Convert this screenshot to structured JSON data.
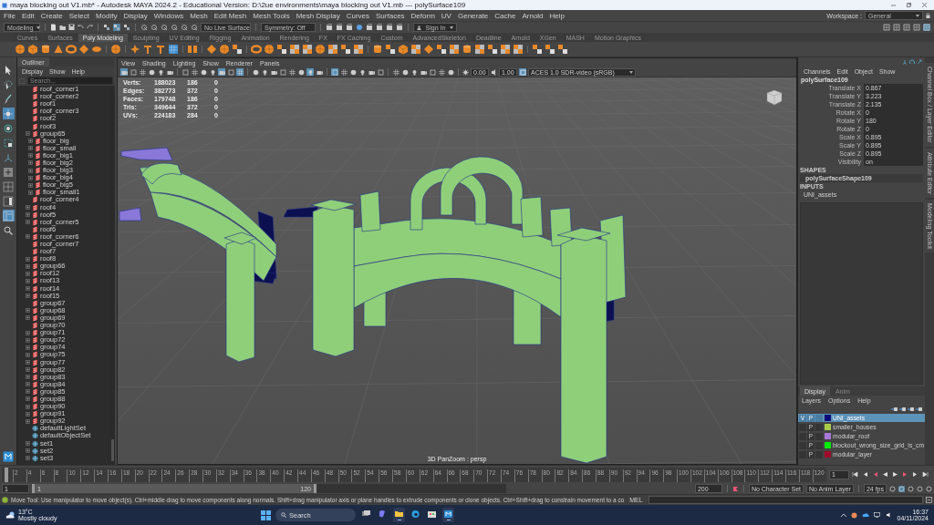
{
  "window": {
    "title": "maya blocking out V1.mb* - Autodesk MAYA 2024.2 - Educational Version: D:\\2ue environments\\maya blocking out V1.mb  ---  polySurface109"
  },
  "menu_bar": [
    "File",
    "Edit",
    "Create",
    "Select",
    "Modify",
    "Display",
    "Windows",
    "Mesh",
    "Edit Mesh",
    "Mesh Tools",
    "Mesh Display",
    "Curves",
    "Surfaces",
    "Deform",
    "UV",
    "Generate",
    "Cache",
    "Arnold",
    "Help"
  ],
  "workspace": {
    "label": "Workspace :",
    "value": "General"
  },
  "status_line": {
    "mode": "Modeling",
    "live_surface": "No Live Surface",
    "symmetry": "Symmetry: Off",
    "sign_in": "Sign In"
  },
  "shelf_tabs": [
    {
      "label": "Curves",
      "selected": false
    },
    {
      "label": "Surfaces",
      "selected": false
    },
    {
      "label": "Poly Modeling",
      "selected": true
    },
    {
      "label": "Sculpting",
      "selected": false
    },
    {
      "label": "UV Editing",
      "selected": false
    },
    {
      "label": "Rigging",
      "selected": false
    },
    {
      "label": "Animation",
      "selected": false
    },
    {
      "label": "Rendering",
      "selected": false
    },
    {
      "label": "FX",
      "selected": false
    },
    {
      "label": "FX Caching",
      "selected": false
    },
    {
      "label": "Custom",
      "selected": false
    },
    {
      "label": "AdvancedSkeleton",
      "selected": false
    },
    {
      "label": "Deadline",
      "selected": false
    },
    {
      "label": "Arnold",
      "selected": false
    },
    {
      "label": "XGen",
      "selected": false
    },
    {
      "label": "MASH",
      "selected": false
    },
    {
      "label": "Motion Graphics",
      "selected": false
    }
  ],
  "tools": [
    {
      "kind": "select",
      "selected": false
    },
    {
      "kind": "lasso",
      "selected": false
    },
    {
      "kind": "paint",
      "selected": false
    },
    {
      "kind": "move",
      "selected": true
    },
    {
      "kind": "rotate",
      "selected": false
    },
    {
      "kind": "scale",
      "selected": false
    },
    {
      "kind": "manipulator",
      "selected": false
    },
    {
      "kind": "single-view",
      "selected": false
    },
    {
      "kind": "four-view",
      "selected": false
    },
    {
      "kind": "two-view",
      "selected": false
    },
    {
      "kind": "outliner-view",
      "selected": true
    },
    {
      "kind": "zoom",
      "selected": false
    }
  ],
  "outliner": {
    "title": "Outliner",
    "menu": [
      "Display",
      "Show",
      "Help"
    ],
    "search_placeholder": "Search...",
    "items": [
      {
        "name": "roof_corner1",
        "kind": "mesh",
        "collapsed": false
      },
      {
        "name": "roof_corner2",
        "kind": "mesh",
        "collapsed": false
      },
      {
        "name": "roof1",
        "kind": "mesh",
        "collapsed": false
      },
      {
        "name": "roof_corner3",
        "kind": "mesh",
        "collapsed": false
      },
      {
        "name": "roof2",
        "kind": "mesh",
        "collapsed": false
      },
      {
        "name": "roof3",
        "kind": "mesh",
        "collapsed": false
      },
      {
        "name": "group65",
        "kind": "mesh",
        "collapsed": false,
        "children": [
          {
            "name": "floor_big",
            "kind": "mesh",
            "collapsed": true
          },
          {
            "name": "floor_small",
            "kind": "mesh",
            "collapsed": true
          },
          {
            "name": "floor_big1",
            "kind": "mesh",
            "collapsed": true
          },
          {
            "name": "floor_big2",
            "kind": "mesh",
            "collapsed": true
          },
          {
            "name": "floor_big3",
            "kind": "mesh",
            "collapsed": true
          },
          {
            "name": "floor_big4",
            "kind": "mesh",
            "collapsed": true
          },
          {
            "name": "floor_big5",
            "kind": "mesh",
            "collapsed": true
          },
          {
            "name": "floor_small1",
            "kind": "mesh",
            "collapsed": true
          }
        ]
      },
      {
        "name": "roof_corner4",
        "kind": "mesh",
        "collapsed": false
      },
      {
        "name": "roof4",
        "kind": "mesh",
        "collapsed": true
      },
      {
        "name": "roof5",
        "kind": "mesh",
        "collapsed": true
      },
      {
        "name": "roof_corner5",
        "kind": "mesh",
        "collapsed": true
      },
      {
        "name": "roof6",
        "kind": "mesh",
        "collapsed": false
      },
      {
        "name": "roof_corner6",
        "kind": "mesh",
        "collapsed": true
      },
      {
        "name": "roof_corner7",
        "kind": "mesh",
        "collapsed": false
      },
      {
        "name": "roof7",
        "kind": "mesh",
        "collapsed": false
      },
      {
        "name": "roof8",
        "kind": "mesh",
        "collapsed": true
      },
      {
        "name": "group66",
        "kind": "mesh",
        "collapsed": true
      },
      {
        "name": "roof12",
        "kind": "mesh",
        "collapsed": true
      },
      {
        "name": "roof13",
        "kind": "mesh",
        "collapsed": true
      },
      {
        "name": "roof14",
        "kind": "mesh",
        "collapsed": true
      },
      {
        "name": "roof15",
        "kind": "mesh",
        "collapsed": true
      },
      {
        "name": "group67",
        "kind": "mesh",
        "collapsed": false
      },
      {
        "name": "group68",
        "kind": "mesh",
        "collapsed": true
      },
      {
        "name": "group69",
        "kind": "mesh",
        "collapsed": true
      },
      {
        "name": "group70",
        "kind": "mesh",
        "collapsed": false
      },
      {
        "name": "group71",
        "kind": "mesh",
        "collapsed": true
      },
      {
        "name": "group72",
        "kind": "mesh",
        "collapsed": true
      },
      {
        "name": "group74",
        "kind": "mesh",
        "collapsed": true
      },
      {
        "name": "group75",
        "kind": "mesh",
        "collapsed": true
      },
      {
        "name": "group77",
        "kind": "mesh",
        "collapsed": true
      },
      {
        "name": "group82",
        "kind": "mesh",
        "collapsed": true
      },
      {
        "name": "group83",
        "kind": "mesh",
        "collapsed": true
      },
      {
        "name": "group84",
        "kind": "mesh",
        "collapsed": true
      },
      {
        "name": "group85",
        "kind": "mesh",
        "collapsed": true
      },
      {
        "name": "group88",
        "kind": "mesh",
        "collapsed": true
      },
      {
        "name": "group90",
        "kind": "mesh",
        "collapsed": true
      },
      {
        "name": "group91",
        "kind": "mesh",
        "collapsed": true
      },
      {
        "name": "group92",
        "kind": "mesh",
        "collapsed": true
      },
      {
        "name": "defaultLightSet",
        "kind": "set",
        "collapsed": false
      },
      {
        "name": "defaultObjectSet",
        "kind": "set",
        "collapsed": false
      },
      {
        "name": "set1",
        "kind": "set",
        "collapsed": true
      },
      {
        "name": "set2",
        "kind": "set",
        "collapsed": true
      },
      {
        "name": "set3",
        "kind": "set",
        "collapsed": true
      }
    ]
  },
  "viewport": {
    "menu": [
      "View",
      "Shading",
      "Lighting",
      "Show",
      "Renderer",
      "Panels"
    ],
    "toolbar_buttons": [
      {
        "selected": true
      },
      {
        "selected": false
      },
      {
        "selected": false
      },
      {
        "selected": false
      },
      {
        "selected": false
      },
      {
        "selected": false
      },
      {
        "selected": false
      },
      {
        "selected": false
      },
      {
        "selected": false
      },
      {
        "selected": false
      },
      {
        "selected": true
      },
      {
        "selected": false
      },
      {
        "selected": true
      },
      {
        "selected": false
      },
      {
        "selected": false
      },
      {
        "selected": false
      },
      {
        "selected": false
      },
      {
        "selected": false
      },
      {
        "selected": false
      },
      {
        "selected": true
      },
      {
        "selected": false
      },
      {
        "selected": true
      },
      {
        "selected": false
      },
      {
        "selected": false
      },
      {
        "selected": false
      },
      {
        "selected": false
      },
      {
        "selected": false
      },
      {
        "selected": false
      },
      {
        "selected": false
      },
      {
        "selected": false
      },
      {
        "selected": false
      },
      {
        "selected": false
      },
      {
        "selected": false
      },
      {
        "selected": false
      }
    ],
    "exposure": "0.00",
    "gamma": "1.00",
    "color_space": "ACES 1.0 SDR-video (sRGB)",
    "hud": [
      {
        "label": "Verts:",
        "values": [
          "188023",
          "186",
          "0"
        ]
      },
      {
        "label": "Edges:",
        "values": [
          "382773",
          "372",
          "0"
        ]
      },
      {
        "label": "Faces:",
        "values": [
          "179748",
          "186",
          "0"
        ]
      },
      {
        "label": "Tris:",
        "values": [
          "349644",
          "372",
          "0"
        ]
      },
      {
        "label": "UVs:",
        "values": [
          "224183",
          "284",
          "0"
        ]
      }
    ],
    "camera": "3D PanZoom : persp"
  },
  "channel_box": {
    "menu": [
      "Channels",
      "Edit",
      "Object",
      "Show"
    ],
    "object": "polySurface109",
    "attributes": [
      {
        "name": "Translate X",
        "value": "0.867"
      },
      {
        "name": "Translate Y",
        "value": "3.223"
      },
      {
        "name": "Translate Z",
        "value": "2.135"
      },
      {
        "name": "Rotate X",
        "value": "0"
      },
      {
        "name": "Rotate Y",
        "value": "180"
      },
      {
        "name": "Rotate Z",
        "value": "0"
      },
      {
        "name": "Scale X",
        "value": "0.895"
      },
      {
        "name": "Scale Y",
        "value": "0.895"
      },
      {
        "name": "Scale Z",
        "value": "0.895"
      },
      {
        "name": "Visibility",
        "value": "on"
      }
    ],
    "shapes_header": "SHAPES",
    "shape": "polySurfaceShape109",
    "inputs_header": "INPUTS",
    "input": "UNI_assets"
  },
  "side_tabs": [
    "Channel Box / Layer Editor",
    "Attribute Editor",
    "Modeling Toolkit"
  ],
  "layer_editor": {
    "tabs": [
      {
        "label": "Display",
        "selected": true
      },
      {
        "label": "Anim",
        "selected": false
      }
    ],
    "menu": [
      "Layers",
      "Options",
      "Help"
    ],
    "layers": [
      {
        "name": "UNI_assets",
        "color": "#0a0a78",
        "selected": true,
        "visibility_label": "V",
        "playback_label": "P"
      },
      {
        "name": "smaller_houses",
        "color": "#a8cc48",
        "selected": false,
        "playback_label": "P"
      },
      {
        "name": "modular_roof",
        "color": "#a878d8",
        "selected": false,
        "playback_label": "P"
      },
      {
        "name": "blockout_wrong_size_grid_is_cm",
        "color": "#00ee00",
        "selected": false,
        "playback_label": "P"
      },
      {
        "name": "modular_layer",
        "color": "#a00a2a",
        "selected": false,
        "playback_label": "P"
      }
    ]
  },
  "timeline": {
    "ticks": [
      "2",
      "4",
      "6",
      "8",
      "10",
      "12",
      "14",
      "16",
      "18",
      "20",
      "22",
      "24",
      "26",
      "28",
      "30",
      "32",
      "34",
      "36",
      "38",
      "40",
      "42",
      "44",
      "46",
      "48",
      "50",
      "52",
      "54",
      "56",
      "58",
      "60",
      "62",
      "64",
      "66",
      "68",
      "70",
      "72",
      "74",
      "76",
      "78",
      "80",
      "82",
      "84",
      "86",
      "88",
      "90",
      "92",
      "94",
      "96",
      "98",
      "100",
      "102",
      "104",
      "106",
      "108",
      "110",
      "112",
      "114",
      "116",
      "118",
      "120"
    ],
    "level": 0,
    "current_frame": "1"
  },
  "range_slider": {
    "start": "1",
    "range_start": "1",
    "range_end": "120",
    "end": "200",
    "level": 0.6,
    "character_set": "No Character Set",
    "anim_layer": "No Anim Layer",
    "fps": "24 fps"
  },
  "help_line": {
    "text": "Move Tool: Use manipulator to move object(s). Ctrl+middle drag to move components along normals. Shift+drag manipulator axis or plane handles to extrude components or clone objects. Ctrl+Shift+drag to constrain movement to a co",
    "command_label": "MEL"
  },
  "taskbar": {
    "temperature": "13°C",
    "weather": "Mostly cloudy",
    "search_placeholder": "Search",
    "apps": [
      {
        "kind": "task-view",
        "active": false
      },
      {
        "kind": "copilot",
        "active": false
      },
      {
        "kind": "folder",
        "active": true
      },
      {
        "kind": "browser",
        "active": false
      },
      {
        "kind": "store",
        "active": false
      },
      {
        "kind": "maya",
        "active": true
      }
    ],
    "time": "16:37",
    "date": "04/11/2024"
  }
}
